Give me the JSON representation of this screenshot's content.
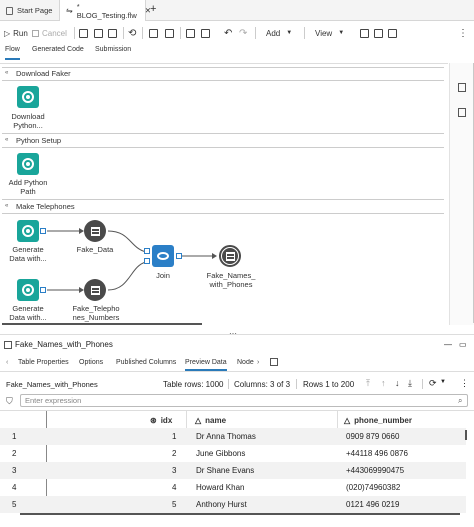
{
  "tabs": [
    {
      "label": "Start Page"
    },
    {
      "label": "* BLOG_Testing.flw"
    }
  ],
  "toolbar": {
    "run": "Run",
    "cancel": "Cancel",
    "add": "Add",
    "view": "View"
  },
  "subtabs": [
    "Flow",
    "Generated Code",
    "Submission"
  ],
  "sections": [
    {
      "title": "Download Faker"
    },
    {
      "title": "Python Setup"
    },
    {
      "title": "Make Telephones"
    }
  ],
  "nodes": {
    "download": "Download\nPython...",
    "python_path": "Add Python\nPath",
    "gen1": "Generate\nData with...",
    "gen2": "Generate\nData with...",
    "fake_data": "Fake_Data",
    "fake_telephones": "Fake_Telepho\nnes_Numbers",
    "join": "Join",
    "output": "Fake_Names_\nwith_Phones"
  },
  "bottom": {
    "title": "Fake_Names_with_Phones",
    "tabs": [
      "Table Properties",
      "Options",
      "Published Columns",
      "Preview Data",
      "Node"
    ],
    "table_name": "Fake_Names_with_Phones",
    "table_rows": "Table rows: 1000",
    "columns": "Columns: 3 of 3",
    "rows_range": "Rows 1 to 200",
    "filter_placeholder": "Enter expression"
  },
  "grid": {
    "headers": [
      "idx",
      "name",
      "phone_number"
    ],
    "rows": [
      {
        "n": "1",
        "idx": "1",
        "name": "Dr Anna Thomas",
        "phone": "0909 879 0660"
      },
      {
        "n": "2",
        "idx": "2",
        "name": "June Gibbons",
        "phone": "+44118 496 0876"
      },
      {
        "n": "3",
        "idx": "3",
        "name": "Dr Shane Evans",
        "phone": "+443069990475"
      },
      {
        "n": "4",
        "idx": "4",
        "name": "Howard Khan",
        "phone": "(020)74960382"
      },
      {
        "n": "5",
        "idx": "5",
        "name": "Anthony Hurst",
        "phone": "0121 496 0219"
      }
    ]
  },
  "colors": {
    "accent": "#2a7ab9",
    "node_teal": "#19a59a",
    "join_blue": "#2b7fc7",
    "table_dark": "#4a4a4a"
  }
}
